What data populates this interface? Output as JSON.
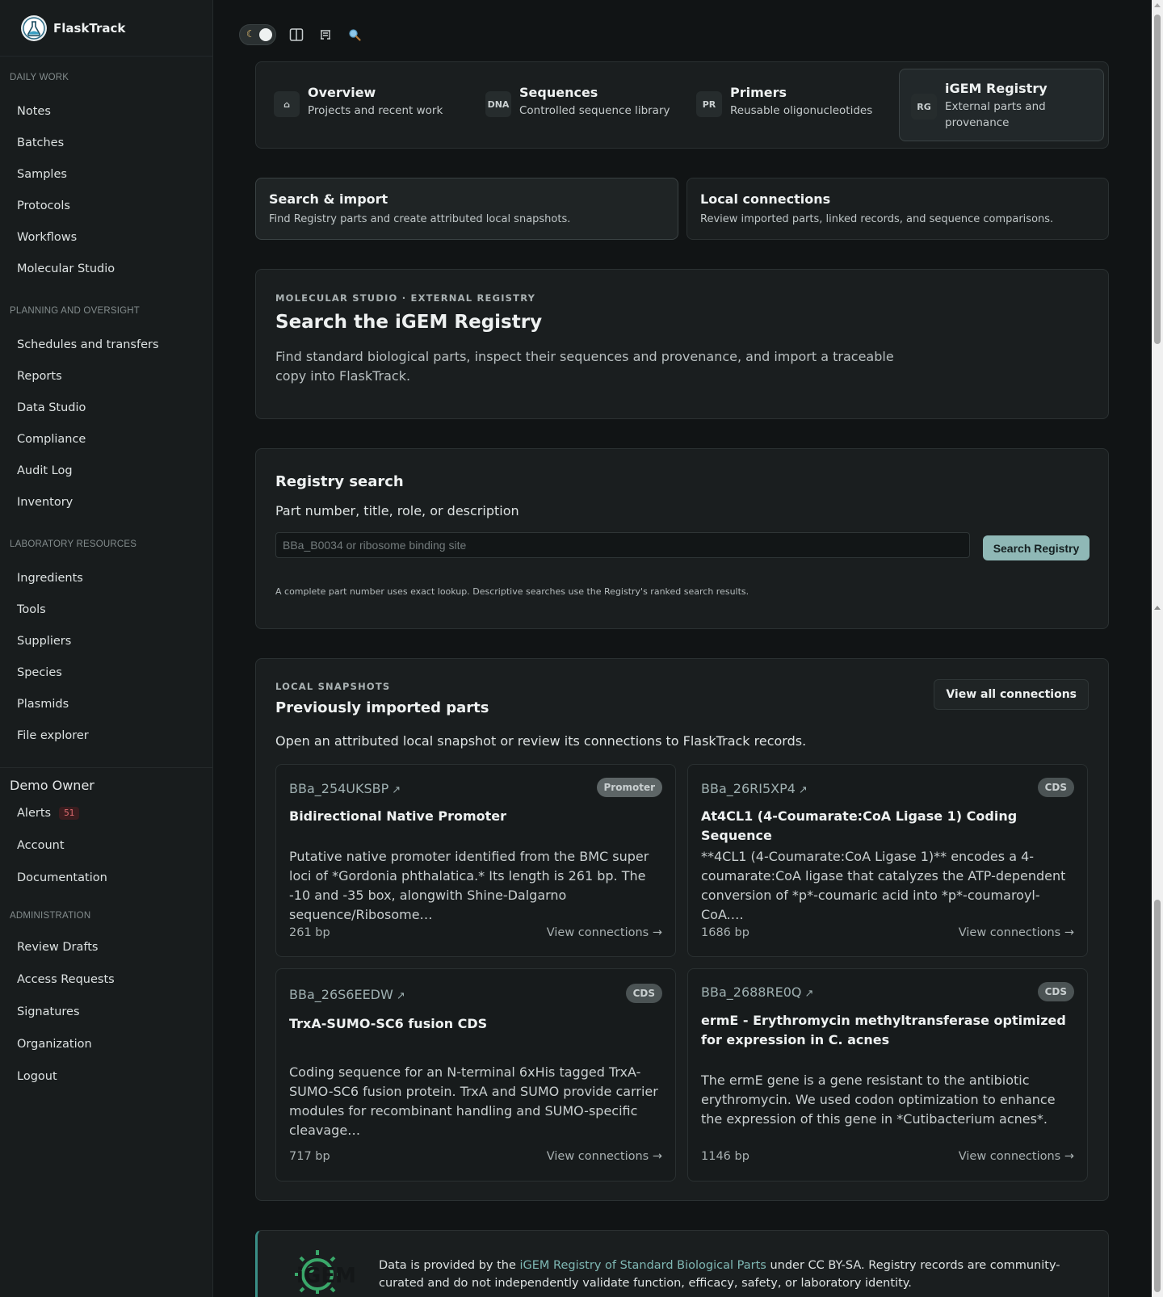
{
  "app": {
    "name": "FlaskTrack"
  },
  "sidebar": {
    "sections": [
      {
        "title": "DAILY WORK",
        "items": [
          "Notes",
          "Batches",
          "Samples",
          "Protocols",
          "Workflows",
          "Molecular Studio"
        ]
      },
      {
        "title": "PLANNING AND OVERSIGHT",
        "items": [
          "Schedules and transfers",
          "Reports",
          "Data Studio",
          "Compliance",
          "Audit Log",
          "Inventory"
        ]
      },
      {
        "title": "LABORATORY RESOURCES",
        "items": [
          "Ingredients",
          "Tools",
          "Suppliers",
          "Species",
          "Plasmids",
          "File explorer"
        ]
      }
    ],
    "user": {
      "name": "Demo Owner",
      "alerts_label": "Alerts",
      "alerts_count": "51",
      "items": [
        "Account",
        "Documentation"
      ]
    },
    "admin": {
      "title": "ADMINISTRATION",
      "items": [
        "Review Drafts",
        "Access Requests",
        "Signatures",
        "Organization",
        "Logout"
      ]
    }
  },
  "toolbar": {
    "icons": [
      "theme-toggle-icon",
      "split-view-icon",
      "rooms-icon",
      "search-icon"
    ]
  },
  "tabs": [
    {
      "icon": "⌂",
      "title": "Overview",
      "subtitle": "Projects and recent work"
    },
    {
      "icon": "DNA",
      "title": "Sequences",
      "subtitle": "Controlled sequence library"
    },
    {
      "icon": "PR",
      "title": "Primers",
      "subtitle": "Reusable oligonucleotides"
    },
    {
      "icon": "RG",
      "title": "iGEM Registry",
      "subtitle": "External parts and provenance",
      "active": true
    }
  ],
  "subtabs": [
    {
      "title": "Search & import",
      "desc": "Find Registry parts and create attributed local snapshots.",
      "active": true
    },
    {
      "title": "Local connections",
      "desc": "Review imported parts, linked records, and sequence comparisons."
    }
  ],
  "intro": {
    "eyebrow": "MOLECULAR STUDIO · EXTERNAL REGISTRY",
    "title": "Search the iGEM Registry",
    "desc": "Find standard biological parts, inspect their sequences and provenance, and import a traceable copy into FlaskTrack."
  },
  "search": {
    "title": "Registry search",
    "label": "Part number, title, role, or description",
    "placeholder": "BBa_B0034 or ribosome binding site",
    "value": "",
    "button": "Search Registry",
    "note": "A complete part number uses exact lookup. Descriptive searches use the Registry's ranked search results."
  },
  "snapshots": {
    "eyebrow": "LOCAL SNAPSHOTS",
    "title": "Previously imported parts",
    "desc": "Open an attributed local snapshot or review its connections to FlaskTrack records.",
    "view_all": "View all connections",
    "link_label": "View connections →",
    "ext_icon": "↗",
    "parts": [
      {
        "id": "BBa_254UKSBP",
        "tag": "Promoter",
        "title": "Bidirectional Native Promoter",
        "desc": "Putative native promoter identified from the BMC super loci of *Gordonia phthalatica.* Its length is 261 bp. The -10 and -35 box, alongwith Shine-Dalgarno sequence/Ribosome…",
        "bp": "261 bp"
      },
      {
        "id": "BBa_26RI5XP4",
        "tag": "CDS",
        "title": "At4CL1 (4-Coumarate:CoA Ligase 1) Coding Sequence",
        "desc": "**4CL1 (4-Coumarate:CoA Ligase 1)** encodes a 4-coumarate:CoA ligase that catalyzes the ATP-dependent conversion of *p*-coumaric acid into *p*-coumaroyl-CoA.…",
        "bp": "1686 bp"
      },
      {
        "id": "BBa_26S6EEDW",
        "tag": "CDS",
        "title": "TrxA-SUMO-SC6 fusion CDS",
        "desc": "Coding sequence for an N-terminal 6xHis tagged TrxA-SUMO-SC6 fusion protein. TrxA and SUMO provide carrier modules for recombinant handling and SUMO-specific cleavage…",
        "bp": "717 bp"
      },
      {
        "id": "BBa_2688RE0Q",
        "tag": "CDS",
        "title": "ermE - Erythromycin methyltransferase optimized for expression in C. acnes",
        "desc": "The ermE gene is a gene resistant to the antibiotic erythromycin. We used codon optimization to enhance the expression of this gene in *Cutibacterium acnes*.",
        "bp": "1146 bp"
      }
    ]
  },
  "footer": {
    "logo_text": "iGEM",
    "text_before": "Data is provided by the ",
    "link": "iGEM Registry of Standard Biological Parts",
    "text_after": " under CC BY-SA. Registry records are community-curated and do not independently validate function, efficacy, safety, or laboratory identity."
  },
  "colors": {
    "accent": "#8fb8b6",
    "background": "#111415",
    "sidebar": "#181c1d",
    "alert": "#e06b70",
    "footer_accent": "#3a8f87"
  }
}
